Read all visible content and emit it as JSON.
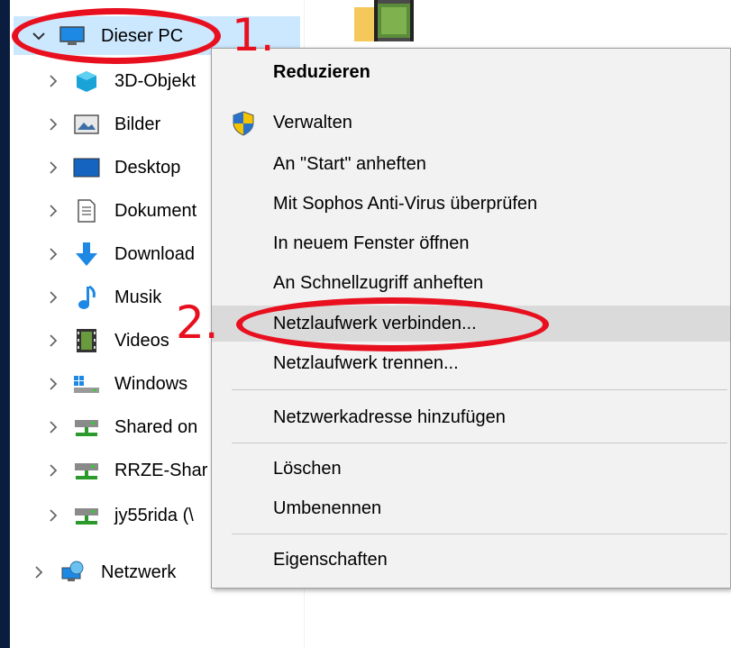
{
  "navigation": {
    "items": [
      {
        "label": "Dieser PC",
        "icon": "monitor-icon",
        "expanded": true
      },
      {
        "label": "3D-Objekt",
        "icon": "3d-objects-icon"
      },
      {
        "label": "Bilder",
        "icon": "pictures-icon"
      },
      {
        "label": "Desktop",
        "icon": "desktop-icon"
      },
      {
        "label": "Dokument",
        "icon": "documents-icon"
      },
      {
        "label": "Download",
        "icon": "download-arrow-icon"
      },
      {
        "label": "Musik",
        "icon": "music-note-icon"
      },
      {
        "label": "Videos",
        "icon": "film-icon"
      },
      {
        "label": "Windows",
        "icon": "windows-drive-icon"
      },
      {
        "label": "Shared on",
        "icon": "network-drive-icon"
      },
      {
        "label": "RRZE-Shar",
        "icon": "network-drive-icon"
      },
      {
        "label": "jy55rida (\\",
        "icon": "network-drive-icon"
      },
      {
        "label": "Netzwerk",
        "icon": "network-icon"
      }
    ]
  },
  "context_menu": {
    "items": [
      {
        "label": "Reduzieren",
        "bold": true
      },
      {
        "label": "Verwalten",
        "icon": "uac-shield-icon"
      },
      {
        "label": "An \"Start\" anheften"
      },
      {
        "label": "Mit Sophos Anti-Virus überprüfen"
      },
      {
        "label": "In neuem Fenster öffnen"
      },
      {
        "label": "An Schnellzugriff anheften"
      },
      {
        "label": "Netzlaufwerk verbinden...",
        "highlighted": true
      },
      {
        "label": "Netzlaufwerk trennen..."
      },
      {
        "label": "Netzwerkadresse hinzufügen"
      },
      {
        "label": "Löschen"
      },
      {
        "label": "Umbenennen"
      },
      {
        "label": "Eigenschaften"
      }
    ]
  },
  "annotations": {
    "step1": "1.",
    "step2": "2.",
    "color": "#e8101f"
  },
  "colors": {
    "selection": "#cce8ff",
    "menu_background": "#f2f2f2",
    "menu_hover": "#dadada"
  }
}
